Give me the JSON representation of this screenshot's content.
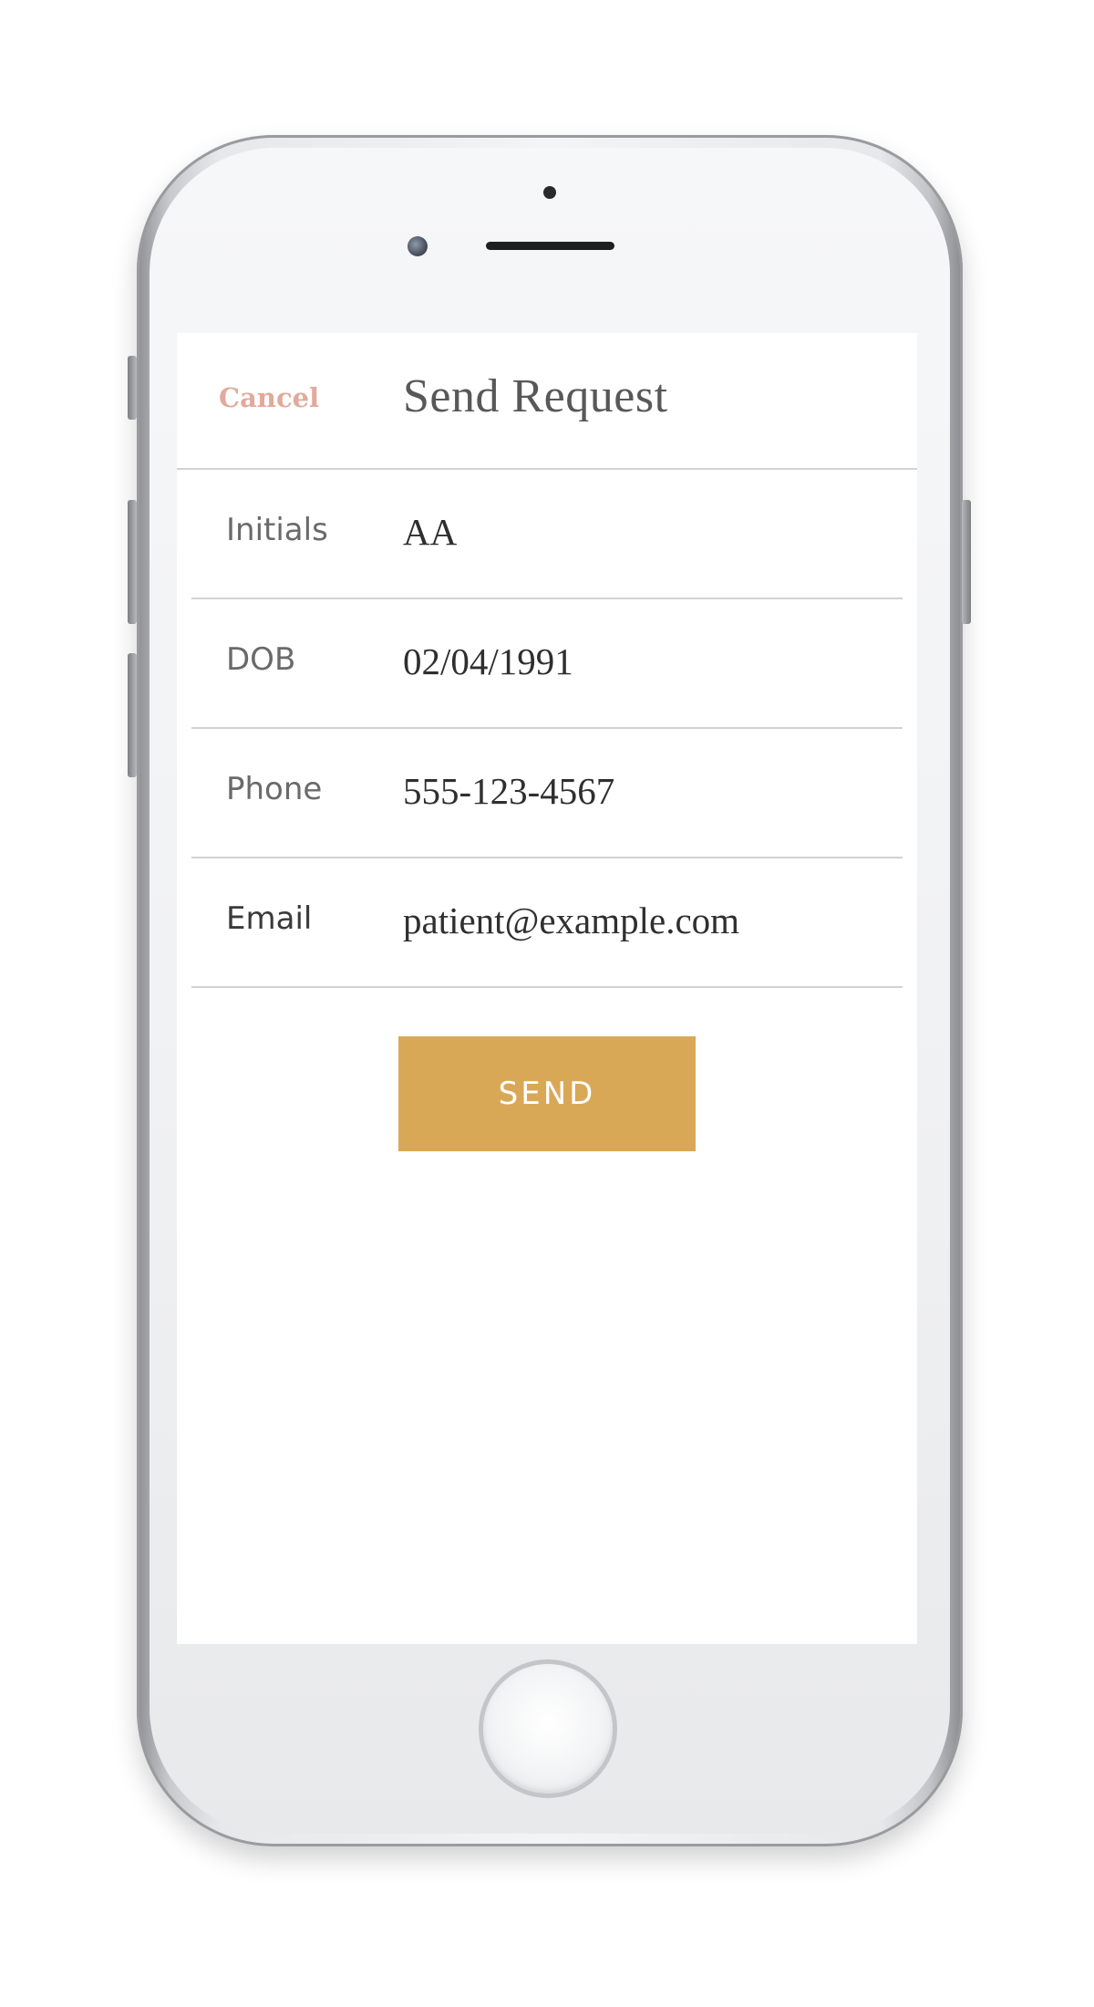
{
  "header": {
    "cancel_label": "Cancel",
    "title": "Send Request"
  },
  "form": {
    "fields": [
      {
        "label": "Initials",
        "value": "AA"
      },
      {
        "label": "DOB",
        "value": "02/04/1991"
      },
      {
        "label": "Phone",
        "value": "555-123-4567"
      },
      {
        "label": "Email",
        "value": "patient@example.com"
      }
    ],
    "send_label": "SEND"
  },
  "colors": {
    "cancel": "#e1aa9c",
    "send_button": "#d9a857",
    "divider": "#d2d2d2"
  }
}
